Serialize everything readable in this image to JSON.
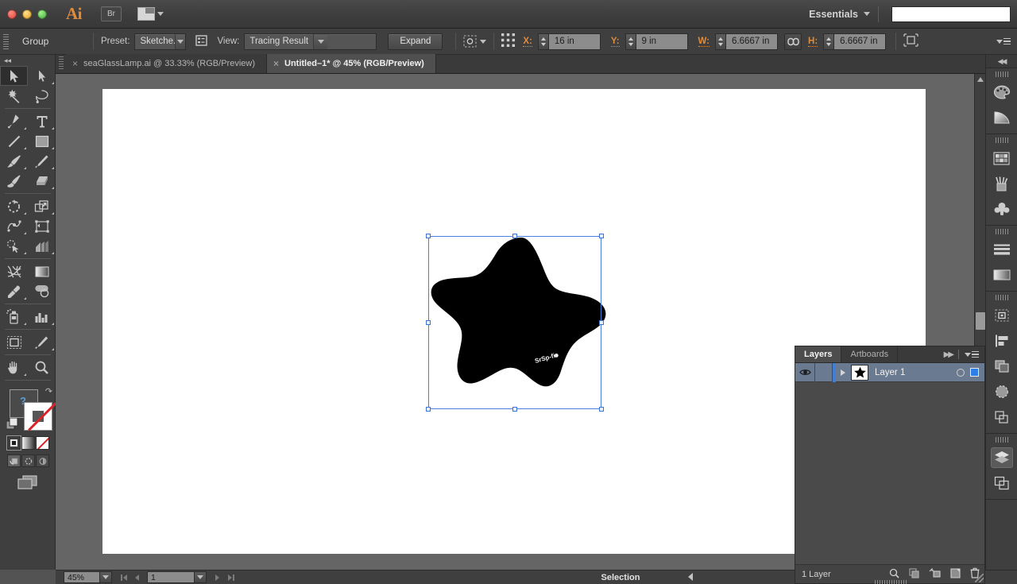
{
  "titlebar": {
    "app_logo": "Ai",
    "bridge_label": "Br",
    "arrange_icon": "arrange-documents-icon",
    "workspace": "Essentials",
    "search_value": "",
    "search_placeholder": ""
  },
  "controlbar": {
    "selection_type": "Group",
    "preset_label": "Preset:",
    "preset_value": "Sketche...",
    "tracing_options_icon": "tracing-options-icon",
    "view_label": "View:",
    "view_value": "Tracing Result",
    "expand_label": "Expand",
    "isolate_icon": "isolate-selected-icon",
    "reference_point_icon": "reference-point-icon",
    "x_label": "X:",
    "x_value": "16 in",
    "y_label": "Y:",
    "y_value": "9 in",
    "w_label": "W:",
    "w_value": "6.6667 in",
    "link_icon": "constrain-proportions-icon",
    "h_label": "H:",
    "h_value": "6.6667 in",
    "transform_icon": "transform-each-icon",
    "panel_menu_icon": "panel-menu-icon"
  },
  "tabs": [
    {
      "title": "seaGlassLamp.ai @ 33.33% (RGB/Preview)",
      "active": false
    },
    {
      "title": "Untitled–1* @ 45% (RGB/Preview)",
      "active": true
    }
  ],
  "toolbar": {
    "rows": [
      [
        {
          "name": "selection-tool",
          "icon": "arrow-solid",
          "selected": true,
          "corner": false
        },
        {
          "name": "direct-selection-tool",
          "icon": "arrow-hollow",
          "selected": false,
          "corner": true
        }
      ],
      [
        {
          "name": "magic-wand-tool",
          "icon": "magic-wand",
          "selected": false,
          "corner": false
        },
        {
          "name": "lasso-tool",
          "icon": "lasso",
          "selected": false,
          "corner": false
        }
      ],
      [
        {
          "name": "pen-tool",
          "icon": "pen",
          "selected": false,
          "corner": true
        },
        {
          "name": "type-tool",
          "icon": "type",
          "selected": false,
          "corner": true
        }
      ],
      [
        {
          "name": "line-segment-tool",
          "icon": "line",
          "selected": false,
          "corner": true
        },
        {
          "name": "rectangle-tool",
          "icon": "rectangle",
          "selected": false,
          "corner": true
        }
      ],
      [
        {
          "name": "paintbrush-tool",
          "icon": "paintbrush",
          "selected": false,
          "corner": true
        },
        {
          "name": "pencil-tool",
          "icon": "pencil",
          "selected": false,
          "corner": true
        }
      ],
      [
        {
          "name": "blob-brush-tool",
          "icon": "blob-brush",
          "selected": false,
          "corner": false
        },
        {
          "name": "eraser-tool",
          "icon": "eraser",
          "selected": false,
          "corner": true
        }
      ],
      [
        {
          "name": "rotate-tool",
          "icon": "rotate",
          "selected": false,
          "corner": true
        },
        {
          "name": "scale-tool",
          "icon": "scale",
          "selected": false,
          "corner": true
        }
      ],
      [
        {
          "name": "width-tool",
          "icon": "width",
          "selected": false,
          "corner": true
        },
        {
          "name": "free-transform-tool",
          "icon": "free-transform",
          "selected": false,
          "corner": false
        }
      ],
      [
        {
          "name": "shape-builder-tool",
          "icon": "shape-builder",
          "selected": false,
          "corner": true
        },
        {
          "name": "perspective-grid-tool",
          "icon": "perspective",
          "selected": false,
          "corner": true
        }
      ],
      [
        {
          "name": "mesh-tool",
          "icon": "mesh",
          "selected": false,
          "corner": false
        },
        {
          "name": "gradient-tool",
          "icon": "gradient",
          "selected": false,
          "corner": false
        }
      ],
      [
        {
          "name": "eyedropper-tool",
          "icon": "eyedropper",
          "selected": false,
          "corner": true
        },
        {
          "name": "blend-tool",
          "icon": "blend",
          "selected": false,
          "corner": false
        }
      ],
      [
        {
          "name": "symbol-sprayer-tool",
          "icon": "symbol-sprayer",
          "selected": false,
          "corner": true
        },
        {
          "name": "column-graph-tool",
          "icon": "column-graph",
          "selected": false,
          "corner": true
        }
      ],
      [
        {
          "name": "artboard-tool",
          "icon": "artboard",
          "selected": false,
          "corner": false
        },
        {
          "name": "slice-tool",
          "icon": "slice",
          "selected": false,
          "corner": true
        }
      ],
      [
        {
          "name": "hand-tool",
          "icon": "hand",
          "selected": false,
          "corner": true
        },
        {
          "name": "zoom-tool",
          "icon": "magnifier",
          "selected": false,
          "corner": false
        }
      ]
    ],
    "fill_stroke": {
      "swap_icon": "swap-fill-stroke-icon",
      "default_icon": "default-fill-stroke-icon",
      "fill_color": "#ffffff",
      "stroke_color": "#ffffff",
      "stroke_none": true
    },
    "paint_modes": [
      {
        "name": "color-mode",
        "active": true
      },
      {
        "name": "gradient-mode",
        "active": false
      },
      {
        "name": "none-mode",
        "active": false
      }
    ],
    "draw_modes": [
      {
        "name": "draw-normal-mode",
        "active": true
      },
      {
        "name": "draw-behind-mode",
        "active": false
      },
      {
        "name": "draw-inside-mode",
        "active": false
      }
    ],
    "screen_mode": "change-screen-mode-icon"
  },
  "canvas": {
    "artwork_name": "traced-star-shape",
    "artwork_fill": "#000000",
    "selection_color": "#4a7fe0",
    "watermark_text": "SrSp-fi"
  },
  "statusbar": {
    "zoom_value": "45%",
    "page_value": "1",
    "status_text": "Selection",
    "first_page_icon": "first-page-icon",
    "prev_page_icon": "prev-page-icon",
    "next_page_icon": "next-page-icon",
    "last_page_icon": "last-page-icon"
  },
  "layers_panel": {
    "tabs": [
      {
        "label": "Layers",
        "active": true
      },
      {
        "label": "Artboards",
        "active": false
      }
    ],
    "collapse_icon": "collapse-panel-icon",
    "menu_icon": "panel-menu-icon",
    "rows": [
      {
        "name": "Layer 1",
        "visible": true,
        "locked": false,
        "expanded": false,
        "selected": true,
        "thumbnail": "star-thumbnail",
        "selection_color": "#2f7fe8"
      }
    ],
    "footer": {
      "count_label": "1 Layer",
      "icons": [
        "locate-object-icon",
        "make-clipping-mask-icon",
        "create-new-sublayer-icon",
        "create-new-layer-icon",
        "delete-selection-icon"
      ]
    }
  },
  "right_dock": {
    "collapse_icon": "collapse-dock-icon",
    "groups": [
      {
        "items": [
          {
            "name": "color-panel-icon",
            "active": false
          },
          {
            "name": "color-guide-panel-icon",
            "active": false
          }
        ]
      },
      {
        "items": [
          {
            "name": "swatches-panel-icon",
            "active": false
          },
          {
            "name": "brushes-panel-icon",
            "active": false
          },
          {
            "name": "symbols-panel-icon",
            "active": false
          }
        ]
      },
      {
        "items": [
          {
            "name": "stroke-panel-icon",
            "active": false
          },
          {
            "name": "gradient-panel-icon",
            "active": false
          }
        ]
      },
      {
        "items": [
          {
            "name": "transform-panel-icon",
            "active": false
          },
          {
            "name": "align-panel-icon",
            "active": false
          },
          {
            "name": "pathfinder-panel-icon",
            "active": false
          },
          {
            "name": "transparency-panel-icon",
            "active": false
          },
          {
            "name": "appearance-panel-icon",
            "active": false
          }
        ]
      },
      {
        "items": [
          {
            "name": "layers-panel-icon",
            "active": true
          },
          {
            "name": "artboards-panel-icon",
            "active": false
          }
        ]
      }
    ]
  }
}
